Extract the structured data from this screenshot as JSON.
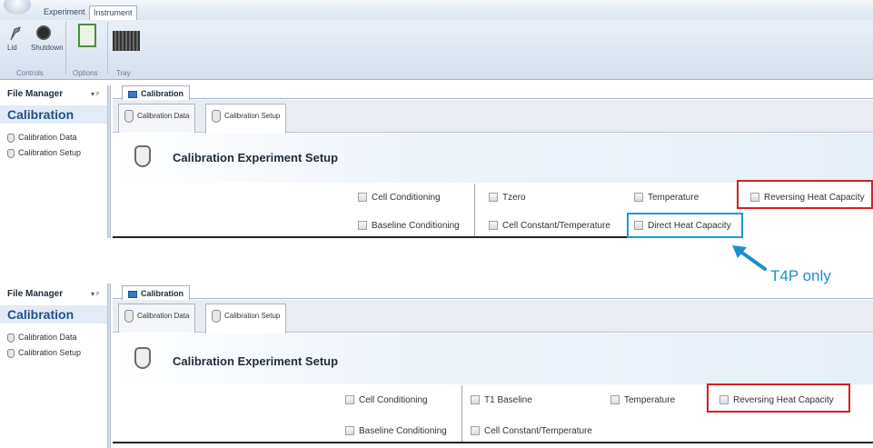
{
  "ribbon": {
    "tabs": [
      "Experiment",
      "Instrument"
    ],
    "buttons": {
      "lid": "Lid",
      "shutdown": "Shutdown"
    },
    "groups": {
      "controls": "Controls",
      "options": "Options",
      "tray": "Tray"
    }
  },
  "top": {
    "file_manager": "File Manager",
    "pin": "▾ ᵖ",
    "panel_title": "Calibration",
    "panel_items": [
      "Calibration Data",
      "Calibration Setup"
    ],
    "doc_tab": "Calibration",
    "inner_tabs": [
      "Calibration Data",
      "Calibration Setup"
    ],
    "setup_title": "Calibration Experiment Setup",
    "row1": [
      "Cell Conditioning",
      "Tzero",
      "Temperature",
      "Reversing Heat Capacity"
    ],
    "row2": [
      "Baseline Conditioning",
      "Cell Constant/Temperature",
      "Direct Heat Capacity"
    ]
  },
  "annotation": {
    "text": "T4P only",
    "color": "#1a8fd0"
  },
  "bottom": {
    "file_manager": "File Manager",
    "pin": "▾ ᵖ",
    "panel_title": "Calibration",
    "panel_items": [
      "Calibration Data",
      "Calibration Setup"
    ],
    "doc_tab": "Calibration",
    "inner_tabs": [
      "Calibration Data",
      "Calibration Setup"
    ],
    "setup_title": "Calibration Experiment Setup",
    "row1": [
      "Cell Conditioning",
      "T1 Baseline",
      "Temperature",
      "Reversing Heat Capacity"
    ],
    "row2": [
      "Baseline Conditioning",
      "Cell Constant/Temperature"
    ]
  },
  "colors": {
    "highlight_red": "#d51f26",
    "highlight_blue": "#1a9ad6",
    "panel_title": "#1f4f8a"
  }
}
